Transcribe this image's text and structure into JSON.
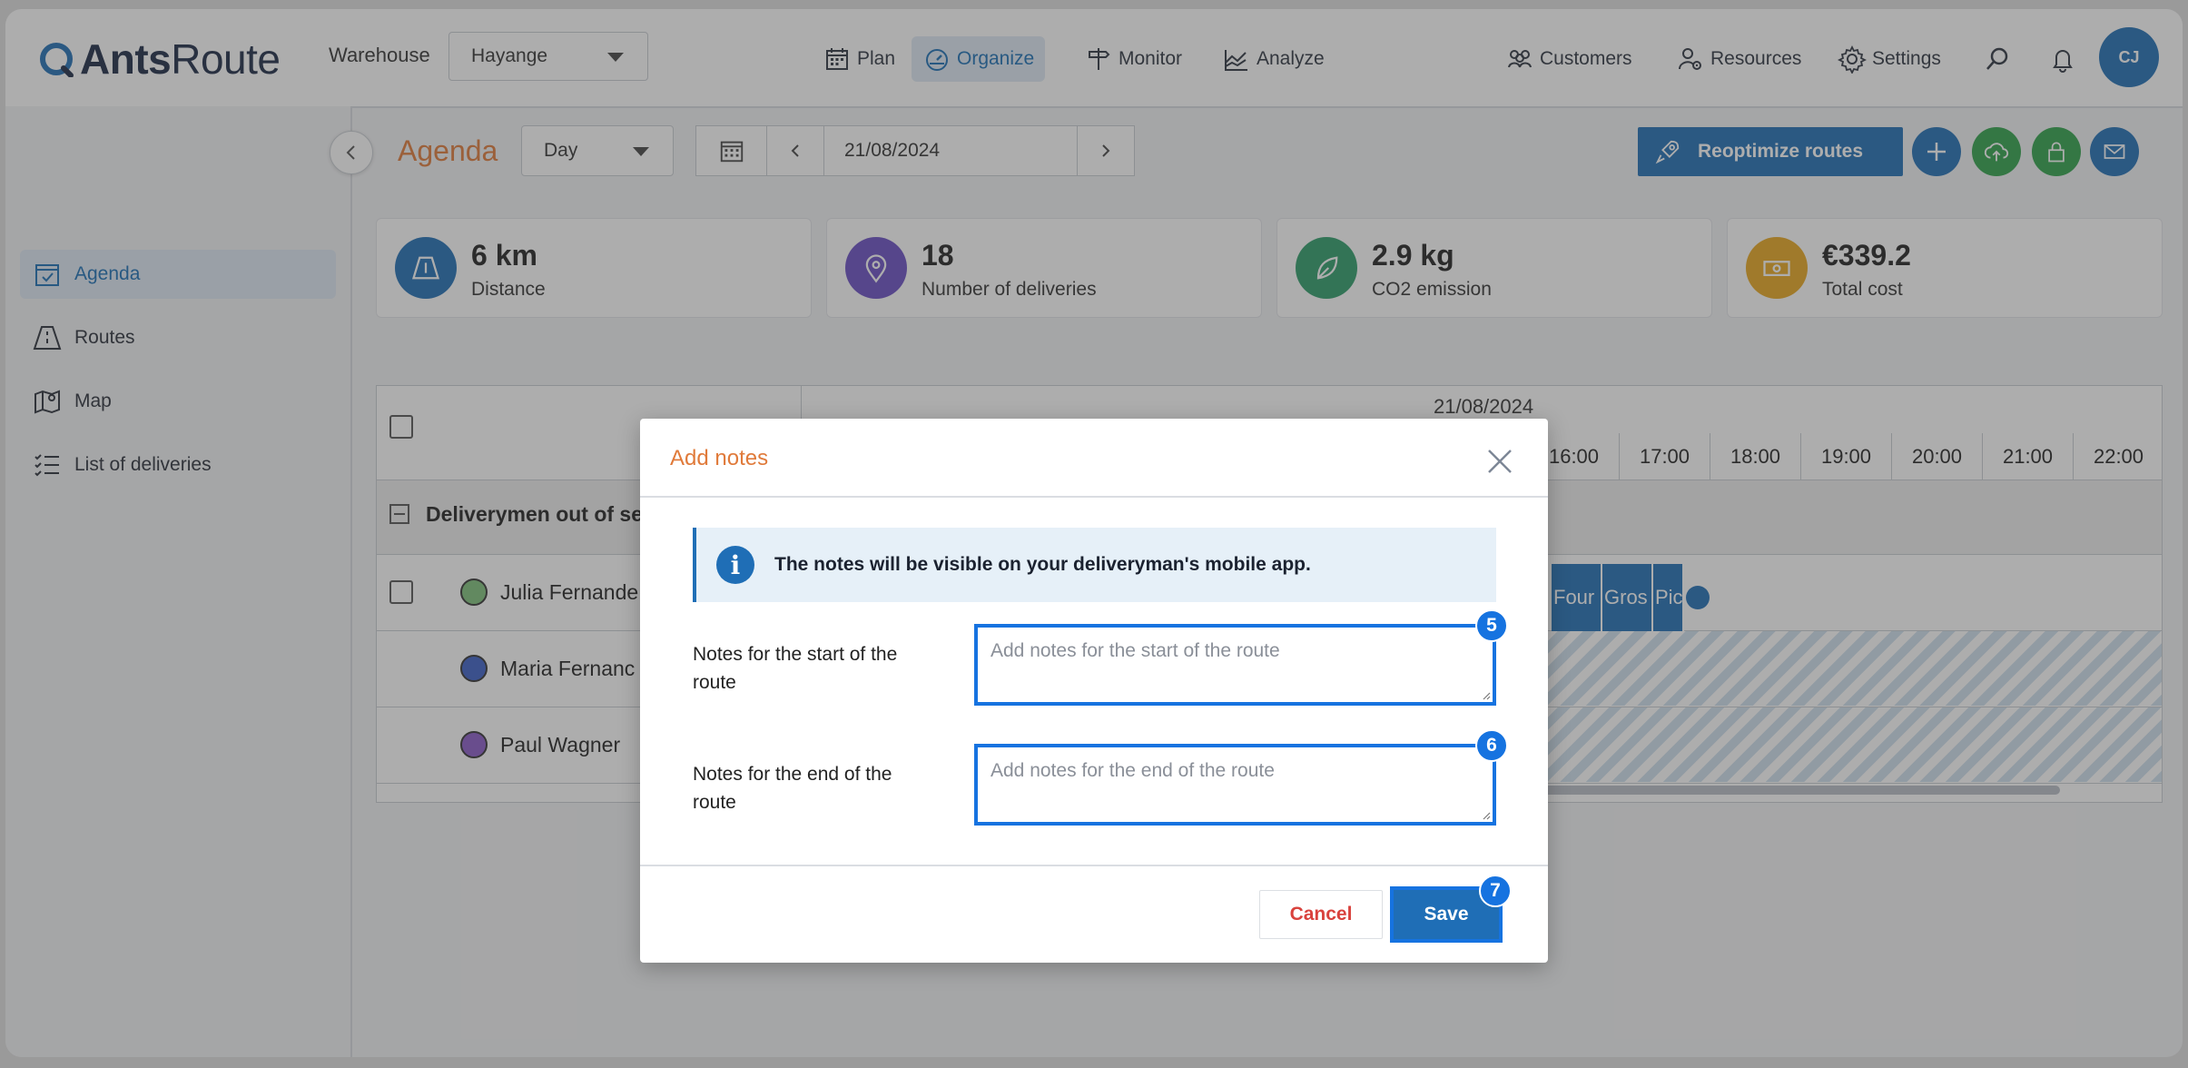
{
  "app": {
    "logo_bold": "Ants",
    "logo_light": "Route"
  },
  "header": {
    "warehouse_label": "Warehouse",
    "warehouse_value": "Hayange",
    "nav": [
      {
        "label": "Plan",
        "icon": "calendar-grid-icon"
      },
      {
        "label": "Organize",
        "icon": "speedometer-icon",
        "active": true
      },
      {
        "label": "Monitor",
        "icon": "signpost-icon"
      },
      {
        "label": "Analyze",
        "icon": "chart-icon"
      }
    ],
    "right_nav": [
      {
        "label": "Customers",
        "icon": "people-icon"
      },
      {
        "label": "Resources",
        "icon": "user-gear-icon"
      },
      {
        "label": "Settings",
        "icon": "gear-icon"
      }
    ],
    "avatar": "CJ"
  },
  "sidebar": {
    "items": [
      {
        "label": "Agenda",
        "active": true
      },
      {
        "label": "Routes"
      },
      {
        "label": "Map"
      },
      {
        "label": "List of deliveries"
      }
    ]
  },
  "toolbar": {
    "title": "Agenda",
    "view_mode": "Day",
    "date": "21/08/2024",
    "reoptimize": "Reoptimize routes"
  },
  "stats": [
    {
      "value": "6 km",
      "label": "Distance",
      "color": "#1f6eb6"
    },
    {
      "value": "18",
      "label": "Number of deliveries",
      "color": "#6a4fc4"
    },
    {
      "value": "2.9 kg",
      "label": "CO2 emission",
      "color": "#2e9e6a"
    },
    {
      "value": "€339.2",
      "label": "Total cost",
      "color": "#e8a820"
    }
  ],
  "schedule": {
    "date": "21/08/2024",
    "times": [
      "16:00",
      "17:00",
      "18:00",
      "19:00",
      "20:00",
      "21:00",
      "22:00"
    ],
    "group": "Deliverymen out of se",
    "rows": [
      {
        "name": "Julia Fernande",
        "color": "#7fc27a"
      },
      {
        "name": "Maria Fernanc",
        "color": "#3b5fc7"
      },
      {
        "name": "Paul Wagner",
        "color": "#8a5bc9"
      }
    ],
    "tasks": [
      "Four",
      "Gros",
      "Pic"
    ]
  },
  "modal": {
    "title": "Add notes",
    "info": "The notes will be visible on your deliveryman's mobile app.",
    "start_label": "Notes for the start of the route",
    "start_placeholder": "Add notes for the start of the route",
    "end_label": "Notes for the end of the route",
    "end_placeholder": "Add notes for the end of the route",
    "cancel": "Cancel",
    "save": "Save",
    "badges": [
      "5",
      "6",
      "7"
    ]
  }
}
